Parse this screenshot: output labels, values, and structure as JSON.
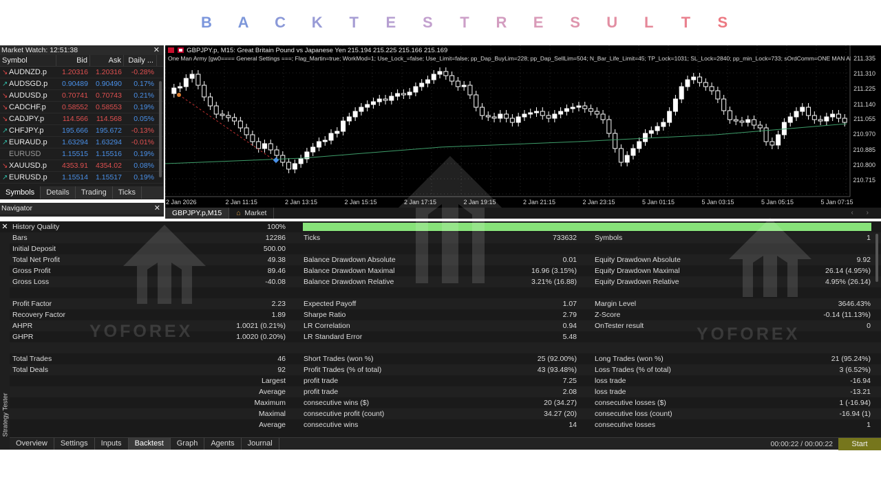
{
  "banner": {
    "letters": [
      "B",
      "A",
      "C",
      "K",
      "T",
      "E",
      "S",
      "T",
      "R",
      "E",
      "S",
      "U",
      "L",
      "T",
      "S"
    ],
    "colors": [
      "#7b96dc",
      "#7d97da",
      "#8b99d8",
      "#989bd6",
      "#a69dd4",
      "#b69fd1",
      "#c2a0ce",
      "#cc9fc8",
      "#d39dc0",
      "#d99bb8",
      "#de95ad",
      "#e28ea2",
      "#e58798",
      "#e9808e",
      "#ec7982"
    ]
  },
  "market_watch": {
    "title": "Market Watch: 12:51:38",
    "columns": {
      "symbol": "Symbol",
      "bid": "Bid",
      "ask": "Ask",
      "daily": "Daily ..."
    },
    "rows": [
      {
        "arrow": "↘",
        "dir": "down",
        "symbol": "AUDNZD.p",
        "bid": "1.20316",
        "ask": "1.20316",
        "daily": "-0.28%"
      },
      {
        "arrow": "↗",
        "dir": "up",
        "symbol": "AUDSGD.p",
        "bid": "0.90489",
        "ask": "0.90490",
        "daily": "0.17%"
      },
      {
        "arrow": "↘",
        "dir": "down",
        "symbol": "AUDUSD.p",
        "bid": "0.70741",
        "ask": "0.70743",
        "daily": "0.21%"
      },
      {
        "arrow": "↘",
        "dir": "down",
        "symbol": "CADCHF.p",
        "bid": "0.58552",
        "ask": "0.58553",
        "daily": "0.19%"
      },
      {
        "arrow": "↘",
        "dir": "down",
        "symbol": "CADJPY.p",
        "bid": "114.566",
        "ask": "114.568",
        "daily": "0.05%"
      },
      {
        "arrow": "↗",
        "dir": "up",
        "symbol": "CHFJPY.p",
        "bid": "195.666",
        "ask": "195.672",
        "daily": "-0.13%"
      },
      {
        "arrow": "↗",
        "dir": "up",
        "symbol": "EURAUD.p",
        "bid": "1.63294",
        "ask": "1.63294",
        "daily": "-0.01%"
      },
      {
        "arrow": "",
        "dir": "dim",
        "symbol": "EURUSD",
        "bid": "1.15515",
        "ask": "1.15516",
        "daily": "0.19%"
      },
      {
        "arrow": "↘",
        "dir": "down",
        "symbol": "XAUUSD.p",
        "bid": "4353.91",
        "ask": "4354.02",
        "daily": "0.08%"
      },
      {
        "arrow": "↗",
        "dir": "up",
        "symbol": "EURUSD.p",
        "bid": "1.15514",
        "ask": "1.15517",
        "daily": "0.19%"
      }
    ],
    "tabs": [
      "Symbols",
      "Details",
      "Trading",
      "Ticks"
    ]
  },
  "navigator": {
    "title": "Navigator"
  },
  "chart": {
    "title": "GBPJPY.p, M15:  Great Britain Pound vs Japanese Yen  215.194 215.225 215.166 215.169",
    "params": "One Man Army [gw0==== General Settings ===; Flag_Martin=true; WorkMod=1; Use_Lock_=false; Use_Limit=false; pp_Dap_BuyLim=228; pp_Dap_SellLim=504; N_Bar_Life_Limit=45; TP_Lock=1031; SL_Lock=2840; pp_min_Lock=733; sOrdComm=ONE MAN ARMY",
    "prices": [
      "211.335",
      "211.310",
      "211.225",
      "211.140",
      "211.055",
      "210.970",
      "210.885",
      "210.800",
      "210.715"
    ],
    "times": [
      "2 Jan 2026",
      "2 Jan 11:15",
      "2 Jan 13:15",
      "2 Jan 15:15",
      "2 Jan 17:15",
      "2 Jan 19:15",
      "2 Jan 21:15",
      "2 Jan 23:15",
      "5 Jan 01:15",
      "5 Jan 03:15",
      "5 Jan 05:15",
      "5 Jan 07:15"
    ],
    "tabs": [
      "GBPJPY.p,M15",
      "Market"
    ],
    "candle_color": "#ffffff",
    "ma_color": "#3e9e6a"
  },
  "results": {
    "history_quality": {
      "label": "History Quality",
      "value": "100%",
      "fill": 1.0
    },
    "rows": [
      {
        "c1l": "Bars",
        "c1v": "12286",
        "c2l": "Ticks",
        "c2v": "733632",
        "c3l": "Symbols",
        "c3v": "1"
      },
      {
        "c1l": "Initial Deposit",
        "c1v": "500.00",
        "c2l": "",
        "c2v": "",
        "c3l": "",
        "c3v": ""
      },
      {
        "c1l": "Total Net Profit",
        "c1v": "49.38",
        "c2l": "Balance Drawdown Absolute",
        "c2v": "0.01",
        "c3l": "Equity Drawdown Absolute",
        "c3v": "9.92"
      },
      {
        "c1l": "Gross Profit",
        "c1v": "89.46",
        "c2l": "Balance Drawdown Maximal",
        "c2v": "16.96 (3.15%)",
        "c3l": "Equity Drawdown Maximal",
        "c3v": "26.14 (4.95%)"
      },
      {
        "c1l": "Gross Loss",
        "c1v": "-40.08",
        "c2l": "Balance Drawdown Relative",
        "c2v": "3.21% (16.88)",
        "c3l": "Equity Drawdown Relative",
        "c3v": "4.95% (26.14)"
      },
      {
        "c1l": "",
        "c1v": "",
        "c2l": "",
        "c2v": "",
        "c3l": "",
        "c3v": ""
      },
      {
        "c1l": "Profit Factor",
        "c1v": "2.23",
        "c2l": "Expected Payoff",
        "c2v": "1.07",
        "c3l": "Margin Level",
        "c3v": "3646.43%"
      },
      {
        "c1l": "Recovery Factor",
        "c1v": "1.89",
        "c2l": "Sharpe Ratio",
        "c2v": "2.79",
        "c3l": "Z-Score",
        "c3v": "-0.14 (11.13%)"
      },
      {
        "c1l": "AHPR",
        "c1v": "1.0021 (0.21%)",
        "c2l": "LR Correlation",
        "c2v": "0.94",
        "c3l": "OnTester result",
        "c3v": "0"
      },
      {
        "c1l": "GHPR",
        "c1v": "1.0020 (0.20%)",
        "c2l": "LR Standard Error",
        "c2v": "5.48",
        "c3l": "",
        "c3v": ""
      },
      {
        "c1l": "",
        "c1v": "",
        "c2l": "",
        "c2v": "",
        "c3l": "",
        "c3v": ""
      },
      {
        "c1l": "Total Trades",
        "c1v": "46",
        "c2l": "Short Trades (won %)",
        "c2v": "25 (92.00%)",
        "c3l": "Long Trades (won %)",
        "c3v": "21 (95.24%)"
      },
      {
        "c1l": "Total Deals",
        "c1v": "92",
        "c2l": "Profit Trades (% of total)",
        "c2v": "43 (93.48%)",
        "c3l": "Loss Trades (% of total)",
        "c3v": "3 (6.52%)"
      },
      {
        "c1l": "",
        "c1v": "Largest",
        "c2l": "profit trade",
        "c2v": "7.25",
        "c3l": "loss trade",
        "c3v": "-16.94"
      },
      {
        "c1l": "",
        "c1v": "Average",
        "c2l": "profit trade",
        "c2v": "2.08",
        "c3l": "loss trade",
        "c3v": "-13.21"
      },
      {
        "c1l": "",
        "c1v": "Maximum",
        "c2l": "consecutive wins ($)",
        "c2v": "20 (34.27)",
        "c3l": "consecutive losses ($)",
        "c3v": "1 (-16.94)"
      },
      {
        "c1l": "",
        "c1v": "Maximal",
        "c2l": "consecutive profit (count)",
        "c2v": "34.27 (20)",
        "c3l": "consecutive loss (count)",
        "c3v": "-16.94 (1)"
      },
      {
        "c1l": "",
        "c1v": "Average",
        "c2l": "consecutive wins",
        "c2v": "14",
        "c3l": "consecutive losses",
        "c3v": "1"
      }
    ]
  },
  "side_label": "Strategy Tester",
  "watermark": "YOFOREX",
  "bottom": {
    "tabs": [
      "Overview",
      "Settings",
      "Inputs",
      "Backtest",
      "Graph",
      "Agents",
      "Journal"
    ],
    "active": "Backtest",
    "timer": "00:00:22 / 00:00:22",
    "start": "Start"
  }
}
